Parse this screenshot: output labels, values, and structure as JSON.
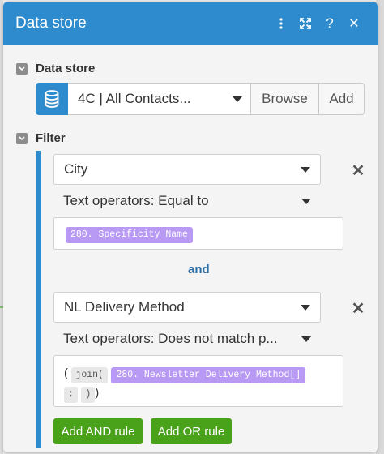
{
  "header": {
    "title": "Data store",
    "icons": [
      "more-vertical-icon",
      "expand-icon",
      "help-icon",
      "close-icon"
    ],
    "help_glyph": "?",
    "close_glyph": "✕"
  },
  "data_store_section": {
    "label": "Data store",
    "selected": "4C | All Contacts...",
    "browse_label": "Browse",
    "add_label": "Add"
  },
  "filter_section": {
    "label": "Filter",
    "rules": [
      {
        "field": "City",
        "operator": "Text operators: Equal to",
        "value_pill": "280. Specificity Name"
      },
      {
        "field": "NL Delivery Method",
        "operator": "Text operators: Does not match p...",
        "open_paren": "(",
        "fn_join": "join(",
        "value_pill": "280. Newsletter Delivery Method[]",
        "separator": ";",
        "fn_close": ")",
        "close_paren": ")"
      }
    ],
    "and_label": "and",
    "add_and_label": "Add AND rule",
    "add_or_label": "Add OR rule",
    "remove_glyph": "✕"
  },
  "colors": {
    "accent_blue": "#2e8bcd",
    "pill_purple": "#b89af4",
    "button_green": "#4aa21a"
  }
}
